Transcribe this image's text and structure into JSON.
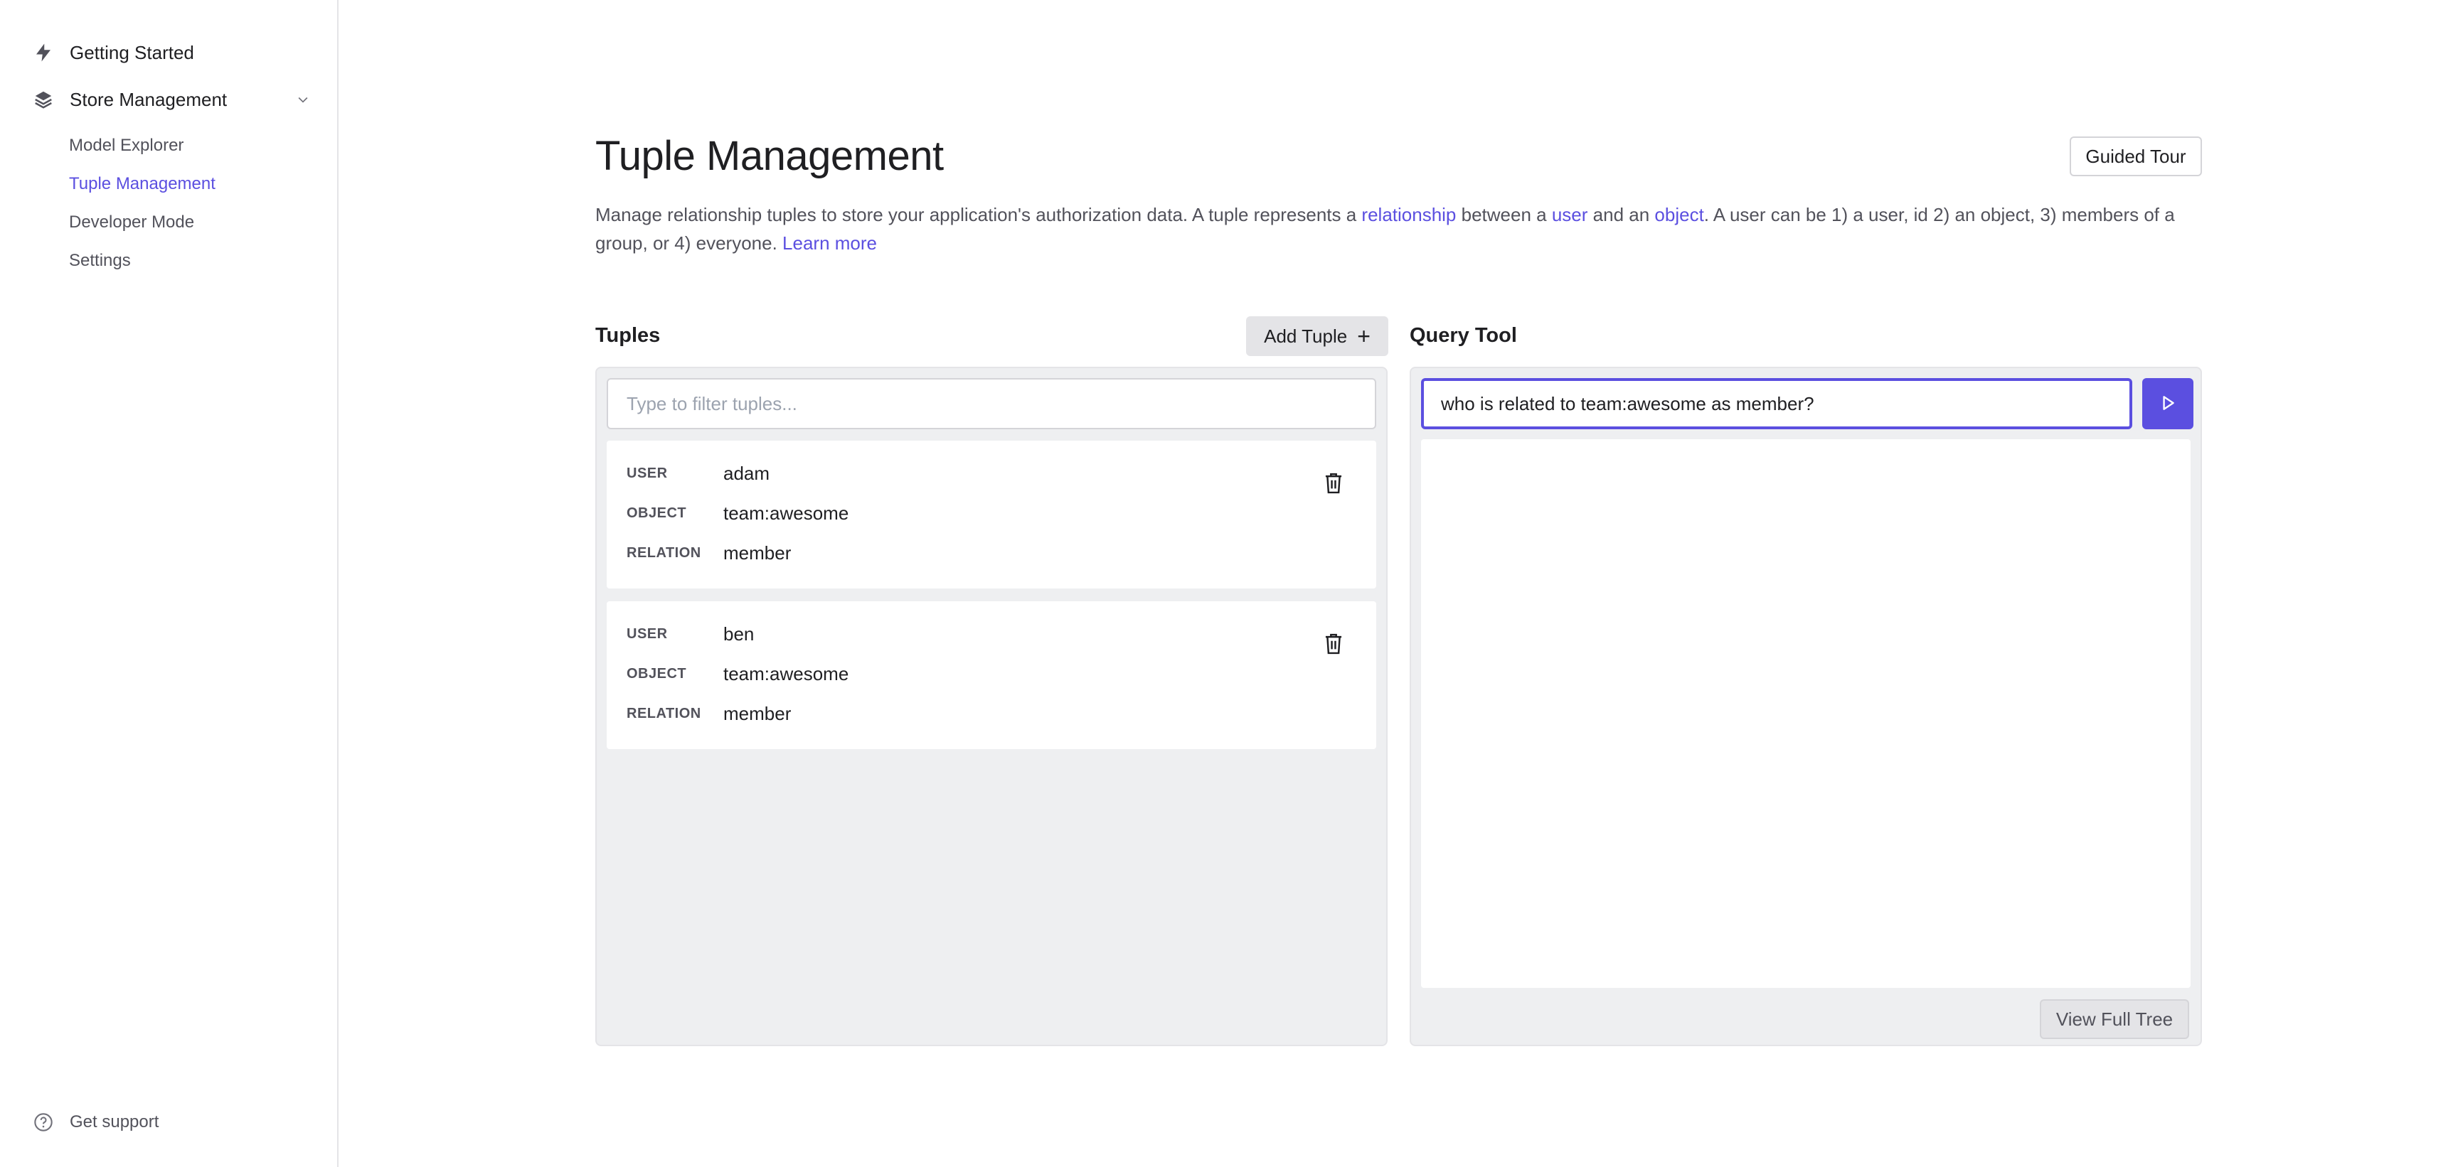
{
  "sidebar": {
    "items": [
      {
        "label": "Getting Started",
        "icon": "lightning-icon"
      },
      {
        "label": "Store Management",
        "icon": "stack-icon"
      }
    ],
    "sub_items": [
      {
        "label": "Model Explorer",
        "active": false
      },
      {
        "label": "Tuple Management",
        "active": true
      },
      {
        "label": "Developer Mode",
        "active": false
      },
      {
        "label": "Settings",
        "active": false
      }
    ],
    "support_label": "Get support"
  },
  "header": {
    "title": "Tuple Management",
    "guided_tour_label": "Guided Tour"
  },
  "description": {
    "part1": "Manage relationship tuples to store your application's authorization data. A tuple represents a ",
    "link_relationship": "relationship",
    "part2": " between a ",
    "link_user": "user",
    "part3": " and an ",
    "link_object": "object",
    "part4": ". A user can be 1) a user, id 2) an object, 3) members of a group, or 4) everyone. ",
    "learn_more": "Learn more"
  },
  "tuples": {
    "title": "Tuples",
    "add_label": "Add Tuple",
    "filter_placeholder": "Type to filter tuples...",
    "keys": {
      "user": "USER",
      "object": "OBJECT",
      "relation": "RELATION"
    },
    "list": [
      {
        "user": "adam",
        "object": "team:awesome",
        "relation": "member"
      },
      {
        "user": "ben",
        "object": "team:awesome",
        "relation": "member"
      }
    ]
  },
  "query": {
    "title": "Query Tool",
    "value": "who is related to team:awesome as member?",
    "view_tree_label": "View Full Tree"
  },
  "colors": {
    "accent": "#5b4fe0",
    "panel_bg": "#eeeff1",
    "border": "#e4e4e7"
  }
}
